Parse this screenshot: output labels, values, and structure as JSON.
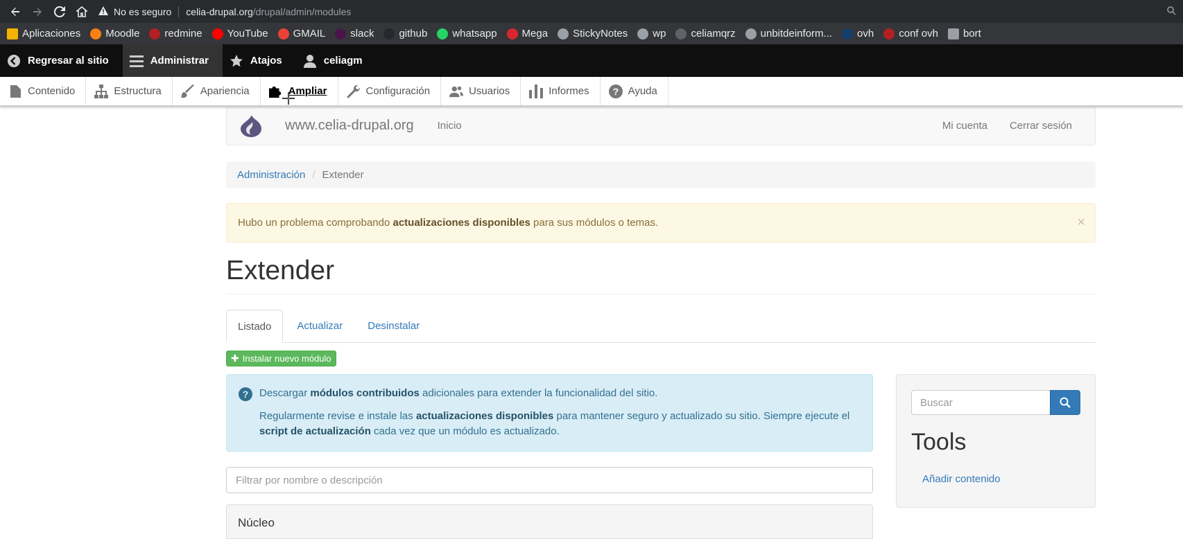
{
  "browser": {
    "security_label": "No es seguro",
    "url_host": "celia-drupal.org",
    "url_path": "/drupal/admin/modules"
  },
  "bookmarks": [
    {
      "label": "Aplicaciones",
      "icon": "apps-grid-icon",
      "color": "#f4b400"
    },
    {
      "label": "Moodle",
      "icon": "moodle-icon",
      "color": "#f98012"
    },
    {
      "label": "redmine",
      "icon": "redmine-icon",
      "color": "#b32024"
    },
    {
      "label": "YouTube",
      "icon": "youtube-icon",
      "color": "#ff0000"
    },
    {
      "label": "GMAIL",
      "icon": "gmail-icon",
      "color": "#ea4335"
    },
    {
      "label": "slack",
      "icon": "slack-icon",
      "color": "#4a154b"
    },
    {
      "label": "github",
      "icon": "github-icon",
      "color": "#24292e"
    },
    {
      "label": "whatsapp",
      "icon": "whatsapp-icon",
      "color": "#25d366"
    },
    {
      "label": "Mega",
      "icon": "mega-icon",
      "color": "#d9272e"
    },
    {
      "label": "StickyNotes",
      "icon": "globe-icon",
      "color": "#9aa0a6"
    },
    {
      "label": "wp",
      "icon": "globe-icon",
      "color": "#9aa0a6"
    },
    {
      "label": "celiamqrz",
      "icon": "globe-icon",
      "color": "#5f6368"
    },
    {
      "label": "unbitdeinform...",
      "icon": "globe-icon",
      "color": "#9aa0a6"
    },
    {
      "label": "ovh",
      "icon": "ovh-icon",
      "color": "#123f6d"
    },
    {
      "label": "conf ovh",
      "icon": "redmine-icon",
      "color": "#b32024"
    },
    {
      "label": "bort",
      "icon": "folder-icon",
      "color": "#9aa0a6"
    }
  ],
  "toolbar": {
    "back": "Regresar al sitio",
    "admin": "Administrar",
    "shortcuts": "Atajos",
    "user": "celiagm"
  },
  "tray": [
    {
      "label": "Contenido",
      "icon": "document-icon"
    },
    {
      "label": "Estructura",
      "icon": "structure-icon"
    },
    {
      "label": "Apariencia",
      "icon": "brush-icon"
    },
    {
      "label": "Ampliar",
      "icon": "puzzle-icon"
    },
    {
      "label": "Configuración",
      "icon": "wrench-icon"
    },
    {
      "label": "Usuarios",
      "icon": "people-icon"
    },
    {
      "label": "Informes",
      "icon": "bar-chart-icon"
    },
    {
      "label": "Ayuda",
      "icon": "help-icon"
    }
  ],
  "site": {
    "name": "www.celia-drupal.org",
    "home": "Inicio",
    "account": "Mi cuenta",
    "logout": "Cerrar sesión"
  },
  "breadcrumb": {
    "parent": "Administración",
    "current": "Extender"
  },
  "alert": {
    "pre": "Hubo un problema comprobando ",
    "bold": "actualizaciones disponibles",
    "post": " para sus módulos o temas.",
    "close": "×"
  },
  "page": {
    "title": "Extender",
    "tabs": [
      "Listado",
      "Actualizar",
      "Desinstalar"
    ],
    "install_button": "Instalar nuevo módulo"
  },
  "info": {
    "p1_pre": "Descargar ",
    "p1_bold": "módulos contribuidos",
    "p1_post": " adicionales para extender la funcionalidad del sitio.",
    "p2_pre": "Regularmente revise e instale las ",
    "p2_bold1": "actualizaciones disponibles",
    "p2_mid": " para mantener seguro y actualizado su sitio. Siempre ejecute el ",
    "p2_bold2": "script de actualización",
    "p2_post": " cada vez que un módulo es actualizado."
  },
  "filter": {
    "placeholder": "Filtrar por nombre o descripción"
  },
  "core_section": {
    "label": "Núcleo"
  },
  "sidebar": {
    "search_placeholder": "Buscar",
    "tools_title": "Tools",
    "add_content": "Añadir contenido"
  }
}
